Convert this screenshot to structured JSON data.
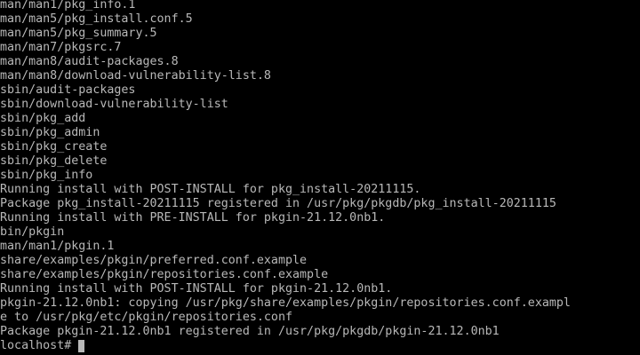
{
  "terminal": {
    "lines": [
      "man/man1/pkg_info.1",
      "man/man5/pkg_install.conf.5",
      "man/man5/pkg_summary.5",
      "man/man7/pkgsrc.7",
      "man/man8/audit-packages.8",
      "man/man8/download-vulnerability-list.8",
      "sbin/audit-packages",
      "sbin/download-vulnerability-list",
      "sbin/pkg_add",
      "sbin/pkg_admin",
      "sbin/pkg_create",
      "sbin/pkg_delete",
      "sbin/pkg_info",
      "Running install with POST-INSTALL for pkg_install-20211115.",
      "Package pkg_install-20211115 registered in /usr/pkg/pkgdb/pkg_install-20211115",
      "Running install with PRE-INSTALL for pkgin-21.12.0nb1.",
      "bin/pkgin",
      "man/man1/pkgin.1",
      "share/examples/pkgin/preferred.conf.example",
      "share/examples/pkgin/repositories.conf.example",
      "Running install with POST-INSTALL for pkgin-21.12.0nb1.",
      "pkgin-21.12.0nb1: copying /usr/pkg/share/examples/pkgin/repositories.conf.exampl",
      "e to /usr/pkg/etc/pkgin/repositories.conf",
      "Package pkgin-21.12.0nb1 registered in /usr/pkg/pkgdb/pkgin-21.12.0nb1"
    ],
    "prompt": "localhost# ",
    "colors": {
      "background": "#000000",
      "foreground": "#b8b8b8"
    }
  }
}
